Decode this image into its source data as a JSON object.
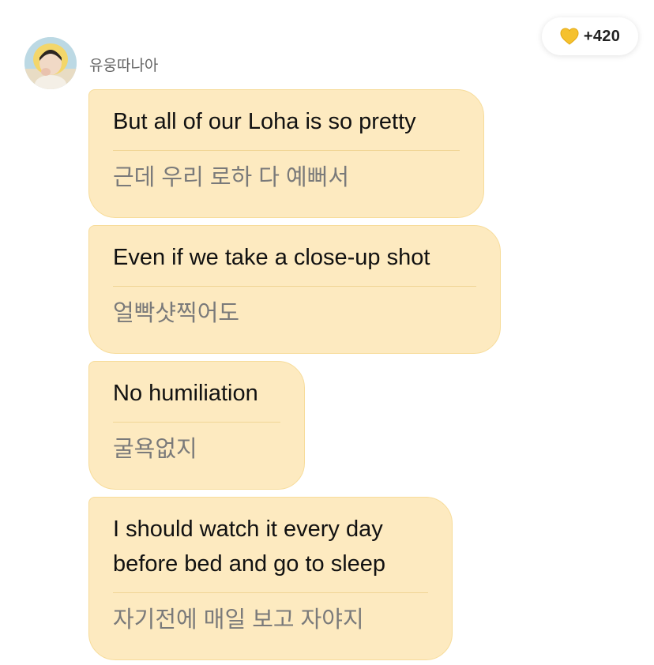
{
  "sender": {
    "name": "유웅따나아",
    "avatar": "avatar-photo"
  },
  "reaction": {
    "icon": "yellow-heart-icon",
    "count": "+420",
    "heart_color": "#F5C12E"
  },
  "colors": {
    "bubble_background": "#FDEAC0",
    "bubble_border": "#F7DC9A",
    "translation_text": "#7A7A7A"
  },
  "messages": [
    {
      "text": "But all of our Loha is so pretty",
      "translation": "근데 우리 로하 다 예뻐서"
    },
    {
      "text": "Even if we take a close-up shot",
      "translation": "얼빡샷찍어도"
    },
    {
      "text": "No humiliation",
      "translation": "굴욕없지"
    },
    {
      "text_lines": [
        "I should watch it every day",
        "before bed and go to sleep"
      ],
      "translation": "자기전에 매일 보고 자야지"
    }
  ]
}
